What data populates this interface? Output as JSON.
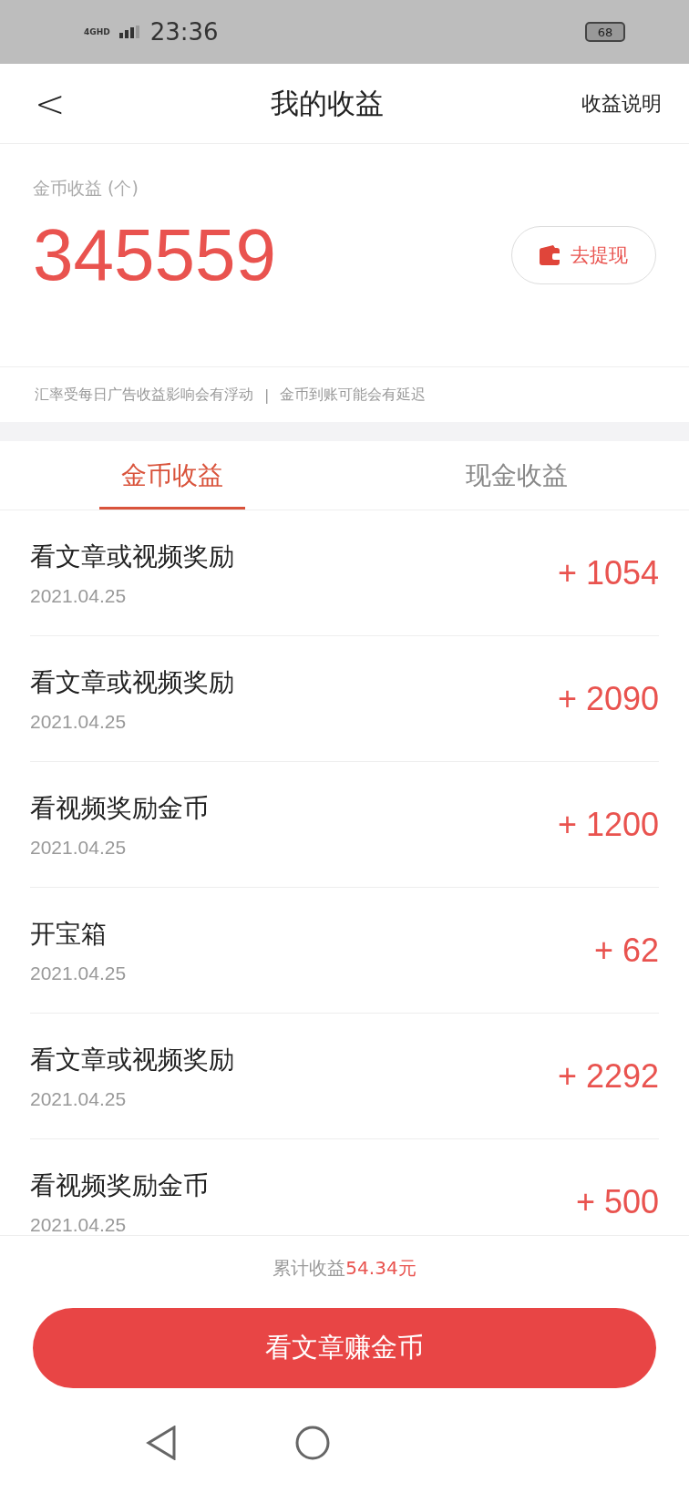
{
  "status_bar": {
    "network": "4GHD",
    "time": "23:36",
    "battery": "68"
  },
  "header": {
    "back": "<",
    "title": "我的收益",
    "action": "收益说明"
  },
  "balance": {
    "label": "金币收益 (个)",
    "amount": "345559",
    "withdraw_button": "去提现"
  },
  "notice": {
    "left": "汇率受每日广告收益影响会有浮动",
    "separator": "|",
    "right": "金币到账可能会有延迟"
  },
  "tabs": [
    {
      "label": "金币收益",
      "selected": true
    },
    {
      "label": "现金收益",
      "selected": false
    }
  ],
  "records": [
    {
      "title": "看文章或视频奖励",
      "date": "2021.04.25",
      "amount": "+ 1054"
    },
    {
      "title": "看文章或视频奖励",
      "date": "2021.04.25",
      "amount": "+ 2090"
    },
    {
      "title": "看视频奖励金币",
      "date": "2021.04.25",
      "amount": "+ 1200"
    },
    {
      "title": "开宝箱",
      "date": "2021.04.25",
      "amount": "+ 62"
    },
    {
      "title": "看文章或视频奖励",
      "date": "2021.04.25",
      "amount": "+ 2292"
    },
    {
      "title": "看视频奖励金币",
      "date": "2021.04.25",
      "amount": "+ 500"
    }
  ],
  "footer": {
    "total": "累计收益**54.34元**",
    "button": "看文章赚金币"
  }
}
